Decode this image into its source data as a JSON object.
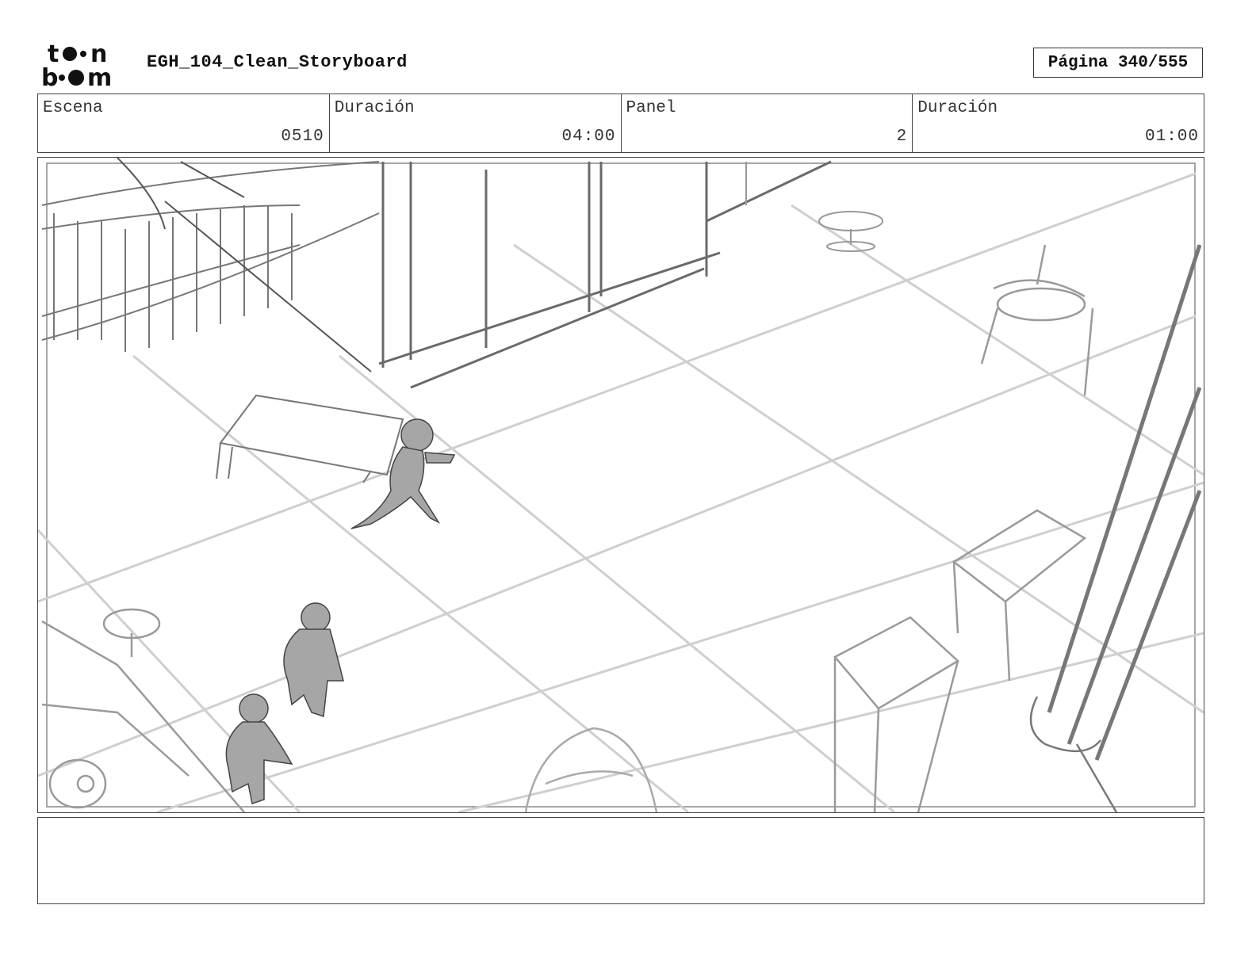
{
  "header": {
    "logo_text": "toon boom",
    "document_title": "EGH_104_Clean_Storyboard",
    "page_label": "Página 340/555"
  },
  "info": {
    "scene_label": "Escena",
    "scene_value": "0510",
    "scene_duration_label": "Duración",
    "scene_duration_value": "04:00",
    "panel_label": "Panel",
    "panel_value": "2",
    "panel_duration_label": "Duración",
    "panel_duration_value": "01:00"
  },
  "notes": {
    "text": ""
  },
  "colors": {
    "sketch_dark": "#555555",
    "sketch_mid": "#8a8a8a",
    "sketch_light": "#c8c8c8",
    "figure_fill": "#a6a6a6"
  }
}
